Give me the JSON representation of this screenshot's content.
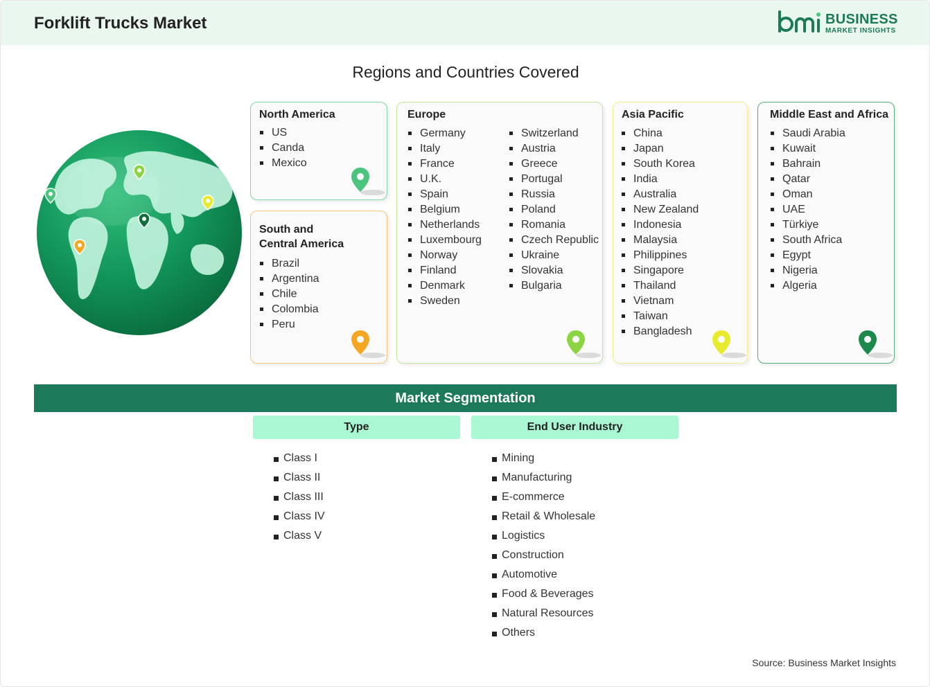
{
  "header": {
    "title": "Forklift Trucks Market",
    "logo": {
      "mark": "bmi",
      "line1": "BUSINESS",
      "line2": "MARKET INSIGHTS",
      "color": "#1c7a56"
    }
  },
  "regions_title": "Regions and Countries Covered",
  "regions": {
    "north_america": {
      "title": "North America",
      "countries": [
        "US",
        "Canda",
        "Mexico"
      ],
      "color": "#4cc47e"
    },
    "south_central_america": {
      "title_line1": "South and",
      "title_line2": "Central America",
      "countries": [
        "Brazil",
        "Argentina",
        "Chile",
        "Colombia",
        "Peru"
      ],
      "color": "#f5a623"
    },
    "europe": {
      "title": "Europe",
      "countries_col1": [
        "Germany",
        "Italy",
        "France",
        "U.K.",
        "Spain",
        "Belgium",
        "Netherlands",
        "Luxembourg",
        "Norway",
        "Finland",
        "Denmark",
        "Sweden"
      ],
      "countries_col2": [
        "Switzerland",
        "Austria",
        "Greece",
        "Portugal",
        "Russia",
        "Poland",
        "Romania",
        "Czech Republic",
        "Ukraine",
        "Slovakia",
        "Bulgaria"
      ],
      "color": "#8dd444"
    },
    "asia_pacific": {
      "title": "Asia Pacific",
      "countries": [
        "China",
        "Japan",
        "South Korea",
        "India",
        "Australia",
        "New Zealand",
        "Indonesia",
        "Malaysia",
        "Philippines",
        "Singapore",
        "Thailand",
        "Vietnam",
        "Taiwan",
        "Bangladesh"
      ],
      "color": "#e8ea2e"
    },
    "middle_east_africa": {
      "title": "Middle East and Africa",
      "countries": [
        "Saudi Arabia",
        "Kuwait",
        "Bahrain",
        "Qatar",
        "Oman",
        "UAE",
        "Türkiye",
        "South Africa",
        "Egypt",
        "Nigeria",
        "Algeria"
      ],
      "color": "#1d8a4c"
    }
  },
  "segmentation": {
    "title": "Market Segmentation",
    "type": {
      "label": "Type",
      "items": [
        "Class I",
        "Class II",
        "Class III",
        "Class IV",
        "Class V"
      ]
    },
    "end_user": {
      "label": "End User Industry",
      "items": [
        "Mining",
        "Manufacturing",
        "E-commerce",
        "Retail & Wholesale",
        "Logistics",
        "Construction",
        "Automotive",
        "Food & Beverages",
        "Natural Resources",
        "Others"
      ]
    }
  },
  "source": "Source: Business Market Insights"
}
